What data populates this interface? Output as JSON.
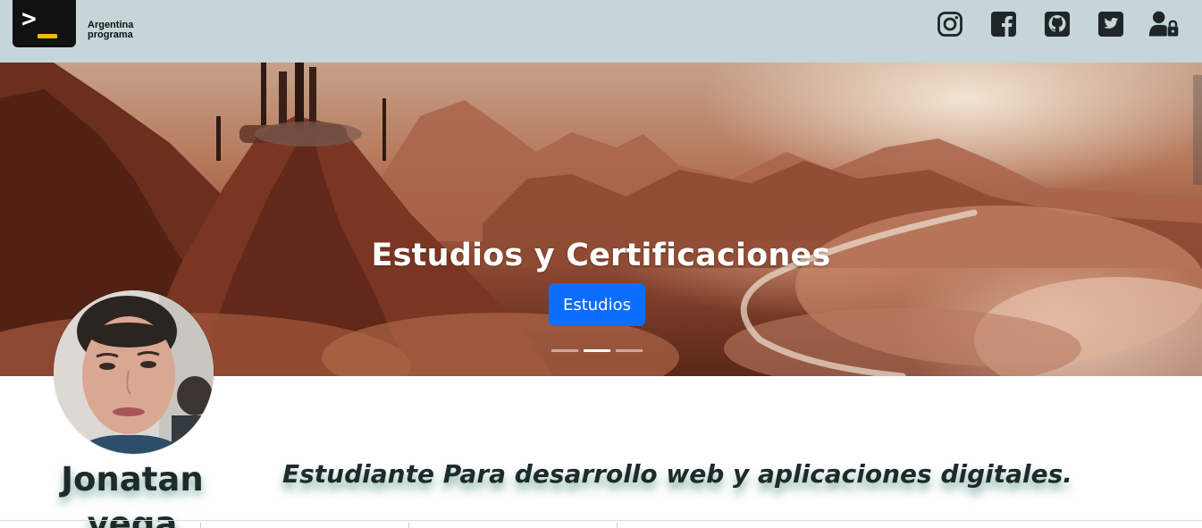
{
  "header": {
    "logo_line1": "Argentina",
    "logo_line2": "programa",
    "logo_prompt": ">",
    "social": [
      {
        "name": "instagram-icon"
      },
      {
        "name": "facebook-icon"
      },
      {
        "name": "github-icon"
      },
      {
        "name": "twitter-icon"
      },
      {
        "name": "user-lock-icon"
      }
    ],
    "bar_color": "#c6d5d7"
  },
  "carousel": {
    "title": "Estudios y Certificaciones",
    "button_label": "Estudios",
    "button_color": "#0d6efd",
    "slide_count": 3,
    "active_slide": 2
  },
  "profile": {
    "name": "Jonatan vega",
    "tagline": "Estudiante Para desarrollo web y aplicaciones digitales."
  }
}
